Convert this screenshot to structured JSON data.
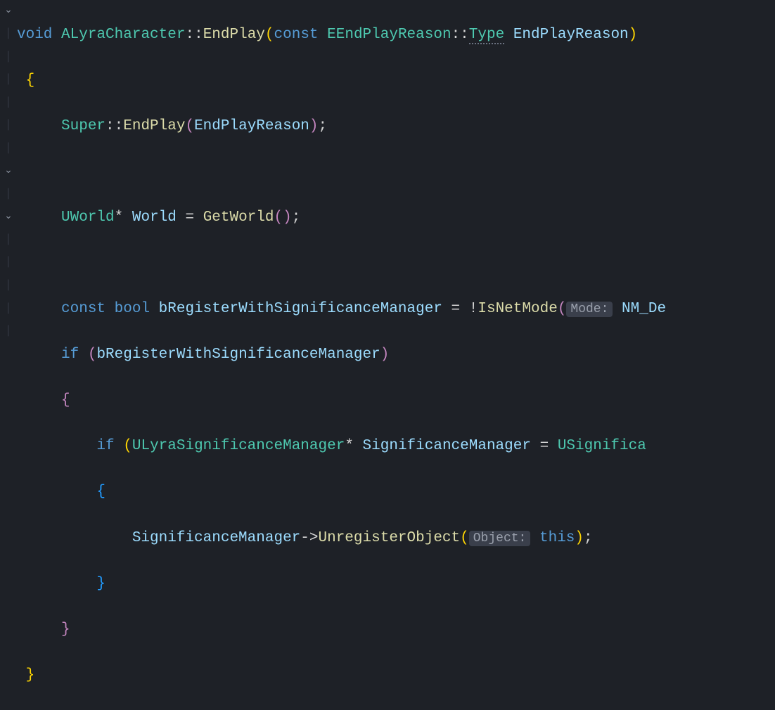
{
  "lines": {
    "l1": {
      "kw_void": "void",
      "cls": "ALyraCharacter",
      "sep": "::",
      "fn": "EndPlay",
      "kw_const": "const",
      "type": "EEndPlayReason",
      "sep2": "::",
      "member": "Type",
      "param": "EndPlayReason"
    },
    "l3": {
      "cls": "Super",
      "sep": "::",
      "fn": "EndPlay",
      "arg": "EndPlayReason"
    },
    "l5": {
      "type": "UWorld",
      "ptr": "*",
      "var": "World",
      "eq": "=",
      "fn": "GetWorld"
    },
    "l7": {
      "kw_const": "const",
      "kw_bool": "bool",
      "var": "bRegisterWithSignificanceManager",
      "eq": "=",
      "not": "!",
      "fn": "IsNetMode",
      "hint": "Mode:",
      "arg": "NM_De"
    },
    "l8": {
      "kw_if": "if",
      "var": "bRegisterWithSignificanceManager"
    },
    "l10": {
      "kw_if": "if",
      "type": "ULyraSignificanceManager",
      "ptr": "*",
      "var": "SignificanceManager",
      "eq": "=",
      "fn": "USignifica"
    },
    "l12": {
      "var": "SignificanceManager",
      "arrow": "->",
      "fn": "UnregisterObject",
      "hint": "Object:",
      "kw_this": "this"
    }
  },
  "glyphs": {
    "chevron": "⌄",
    "pipe": "│"
  }
}
